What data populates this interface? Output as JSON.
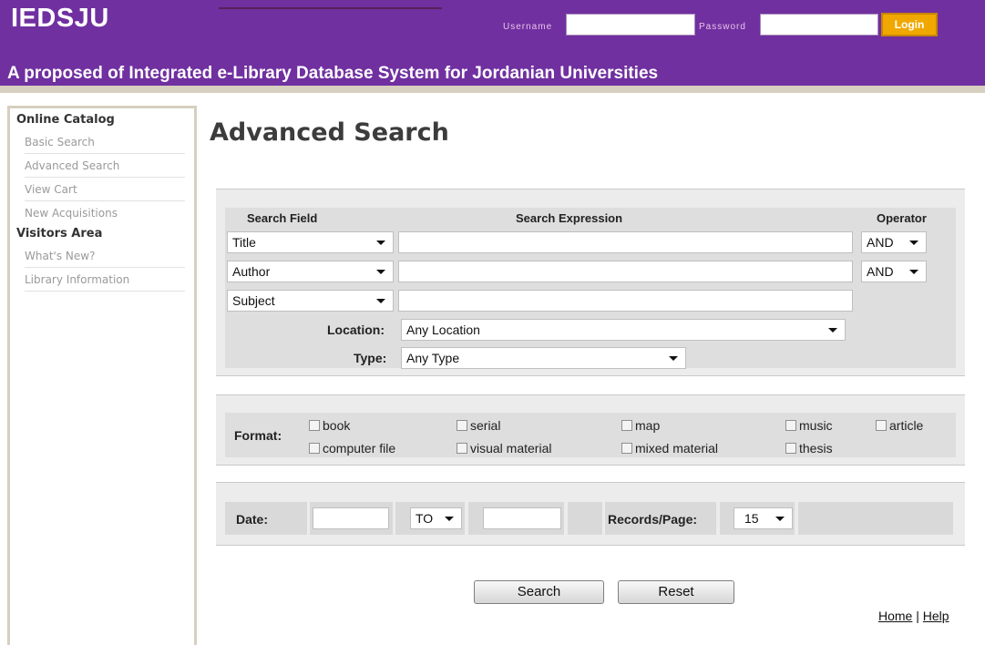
{
  "header": {
    "brand": "IEDSJU",
    "tagline": "A proposed of Integrated e-Library Database System for Jordanian Universities",
    "username_label": "Username",
    "password_label": "Password",
    "username_value": "",
    "password_value": "",
    "login_label": "Login",
    "colors": {
      "header_bg": "#7030a0",
      "login_bg": "#f0a800"
    }
  },
  "sidebar": {
    "sections": [
      {
        "title": "Online Catalog",
        "items": [
          "Basic Search",
          "Advanced Search",
          "View Cart",
          "New Acquisitions"
        ]
      },
      {
        "title": "Visitors Area",
        "items": [
          "What's New?",
          "Library Information"
        ]
      }
    ]
  },
  "main": {
    "title": "Advanced Search",
    "search": {
      "headers": {
        "field": "Search Field",
        "expression": "Search Expression",
        "operator": "Operator"
      },
      "rows": [
        {
          "field": "Title",
          "expression": "",
          "operator": "AND"
        },
        {
          "field": "Author",
          "expression": "",
          "operator": "AND"
        },
        {
          "field": "Subject",
          "expression": ""
        }
      ],
      "location_label": "Location:",
      "location_value": "Any Location",
      "type_label": "Type:",
      "type_value": "Any Type"
    },
    "format": {
      "label": "Format:",
      "options": [
        "book",
        "serial",
        "map",
        "music",
        "article",
        "computer file",
        "visual material",
        "mixed material",
        "thesis"
      ]
    },
    "date": {
      "label": "Date:",
      "from_value": "",
      "to_label": "TO",
      "to_value": "",
      "records_label": "Records/Page:",
      "records_value": "15"
    },
    "buttons": {
      "search": "Search",
      "reset": "Reset"
    },
    "footer": {
      "home": "Home",
      "separator": "|",
      "help": "Help"
    }
  }
}
